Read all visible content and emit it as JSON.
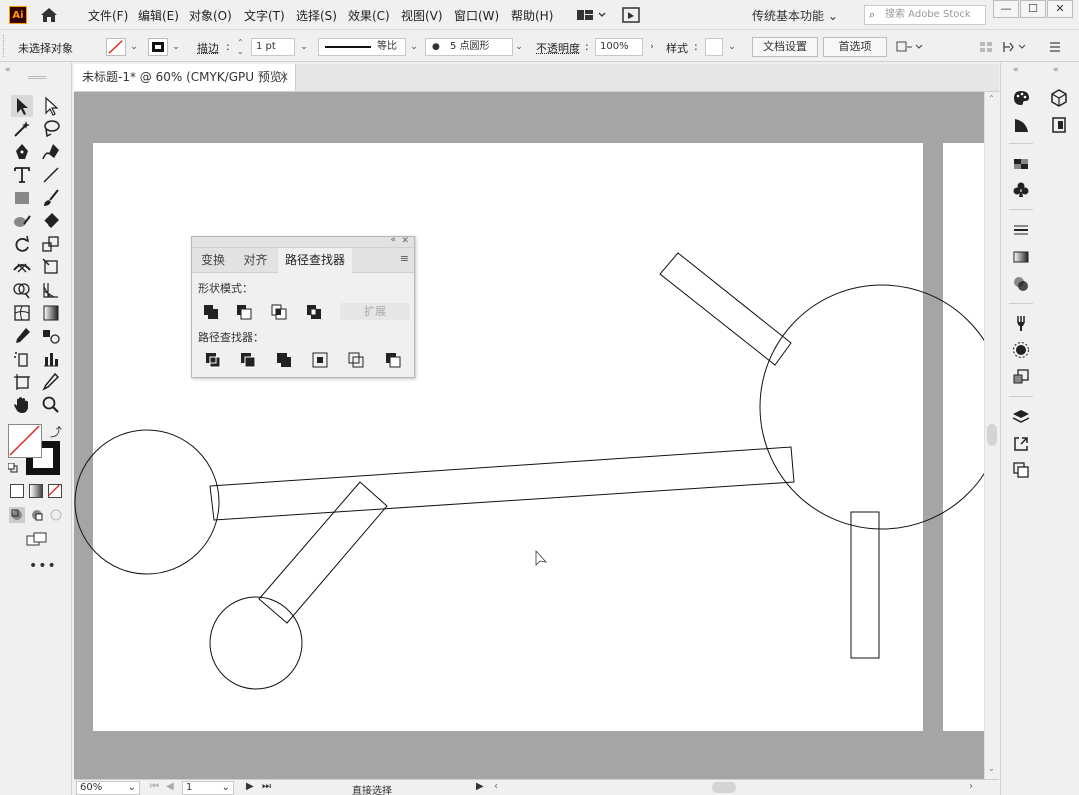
{
  "menubar": {
    "logo": "Ai",
    "menus": [
      "文件(F)",
      "编辑(E)",
      "对象(O)",
      "文字(T)",
      "选择(S)",
      "效果(C)",
      "视图(V)",
      "窗口(W)",
      "帮助(H)"
    ],
    "workspace": "传统基本功能",
    "search_placeholder": "搜索 Adobe Stock",
    "minimize": "—",
    "maximize": "☐",
    "close": "✕"
  },
  "controlbar": {
    "selection_status": "未选择对象",
    "stroke_label": "描边",
    "stroke_weight": "1 pt",
    "profile_label": "等比",
    "brush_label": "5 点圆形",
    "opacity_label": "不透明度",
    "opacity_value": "100%",
    "style_label": "样式",
    "doc_setup_button": "文档设置",
    "preferences_button": "首选项"
  },
  "document": {
    "tab_title": "未标题-1* @ 60% (CMYK/GPU 预览)"
  },
  "pathfinder_panel": {
    "tabs": [
      "变换",
      "对齐",
      "路径查找器"
    ],
    "active_tab": "路径查找器",
    "shape_modes_label": "形状模式：",
    "expand_button": "扩展",
    "pathfinders_label": "路径查找器："
  },
  "statusbar": {
    "zoom": "60%",
    "artboard_number": "1",
    "current_tool": "直接选择"
  },
  "colors": {
    "canvas_bg": "#a5a5a5",
    "artboard": "#ffffff",
    "fill_none_slash": "#e0201c",
    "logo_bg": "#330000",
    "logo_fg": "#ff9a00"
  }
}
